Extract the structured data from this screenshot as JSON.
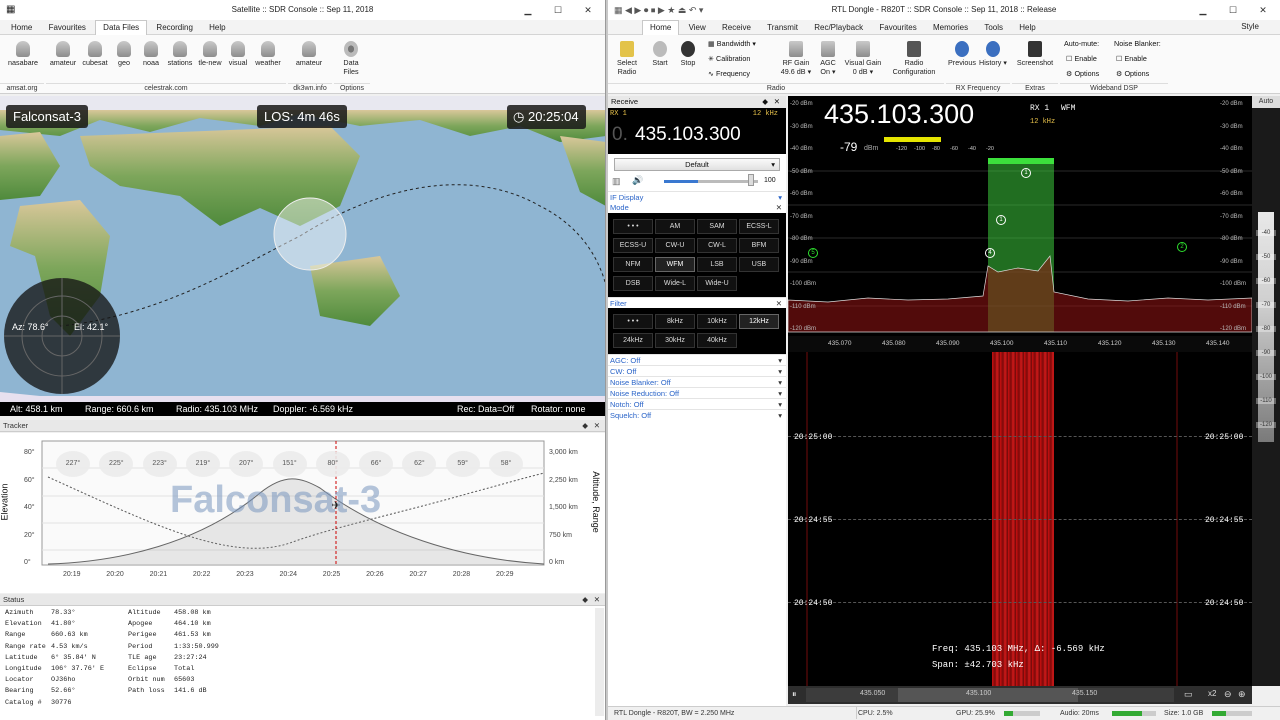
{
  "left": {
    "title": "Satellite :: SDR Console :: Sep 11, 2018",
    "tabs": [
      "Home",
      "Favourites",
      "Data Files",
      "Recording",
      "Help"
    ],
    "active_tab": "Data Files",
    "ribbon_buttons": [
      "nasabare",
      "amateur",
      "cubesat",
      "geo",
      "noaa",
      "stations",
      "tle-new",
      "visual",
      "weather",
      "amateur",
      "Data Files"
    ],
    "group_labels": [
      "amsat.org",
      "celestrak.com",
      "dk3wn.info",
      "Options"
    ],
    "map": {
      "sat_name": "Falconsat-3",
      "los": "LOS: 4m 46s",
      "clock": "20:25:04",
      "az": "Az: 78.6°",
      "el": "El: 42.1°",
      "info": {
        "alt": "Alt: 458.1 km",
        "range": "Range: 660.6 km",
        "radio": "Radio: 435.103 MHz",
        "doppler": "Doppler: -6.569 kHz",
        "rec": "Rec: Data=Off",
        "rotator": "Rotator: none"
      }
    },
    "tracker": {
      "title": "Tracker",
      "watermark": "Falconsat-3",
      "ylabel": "Elevation",
      "y2label": "Altitude, Range",
      "yticks": [
        "80°",
        "60°",
        "40°",
        "20°",
        "0°"
      ],
      "y2ticks": [
        "3,000 km",
        "2,250 km",
        "1,500 km",
        "750 km",
        "0 km"
      ],
      "xticks": [
        "20:19",
        "20:20",
        "20:21",
        "20:22",
        "20:23",
        "20:24",
        "20:25",
        "20:26",
        "20:27",
        "20:28",
        "20:29"
      ],
      "azimuths": [
        "227°",
        "225°",
        "223°",
        "219°",
        "207°",
        "151°",
        "80°",
        "66°",
        "62°",
        "59°",
        "58°"
      ]
    },
    "status": {
      "title": "Status",
      "col1": [
        [
          "Azimuth",
          "78.33°"
        ],
        [
          "Elevation",
          "41.80°"
        ],
        [
          "Range",
          "660.63 km"
        ],
        [
          "Range rate",
          "4.53 km/s"
        ],
        [
          "Latitude",
          "6° 35.84' N"
        ],
        [
          "Longitude",
          "106° 37.76' E"
        ],
        [
          "Locator",
          "OJ36ho"
        ],
        [
          "Bearing",
          "52.66°"
        ],
        [
          "Catalog #",
          "30776"
        ]
      ],
      "col2": [
        [
          "Altitude",
          "458.08 km"
        ],
        [
          "Apogee",
          "464.10 km"
        ],
        [
          "Perigee",
          "461.53 km"
        ],
        [
          "Period",
          "1:33:50.999"
        ],
        [
          "TLE age",
          "23:27:24"
        ],
        [
          "Eclipse",
          "Total"
        ],
        [
          "Orbit num",
          "65603"
        ],
        [
          "Path loss",
          "141.6 dB"
        ]
      ]
    }
  },
  "right": {
    "title": "RTL Dongle - R820T :: SDR Console :: Sep 11, 2018 :: Release",
    "style_label": "Style",
    "tabs": [
      "Home",
      "View",
      "Receive",
      "Transmit",
      "Rec/Playback",
      "Favourites",
      "Memories",
      "Tools",
      "Help"
    ],
    "active_tab": "Home",
    "ribbon": {
      "select_radio": "Select Radio",
      "start": "Start",
      "stop": "Stop",
      "bandwidth": "Bandwidth",
      "calibration": "Calibration",
      "frequency": "Frequency",
      "rf_gain": "RF Gain",
      "rf_gain_val": "49.6 dB",
      "agc": "AGC",
      "agc_val": "On",
      "visual_gain": "Visual Gain",
      "visual_gain_val": "0 dB",
      "radio_config": "Radio Configuration",
      "previous": "Previous",
      "history": "History",
      "screenshot": "Screenshot",
      "automute": "Auto-mute:",
      "enable1": "Enable",
      "options1": "Options",
      "noise_blanker": "Noise Blanker:",
      "enable2": "Enable",
      "options2": "Options",
      "groups": [
        "Radio",
        "RX Frequency",
        "Extras",
        "Wideband DSP"
      ]
    },
    "receive": {
      "title": "Receive",
      "rx": "RX 1",
      "bw": "12 kHz",
      "freq_prefix": "0.",
      "freq": "435.103.300",
      "preset": "Default",
      "volume": "100",
      "if_display": "IF Display",
      "mode": "Mode",
      "modes": [
        "• • •",
        "AM",
        "SAM",
        "ECSS-L",
        "ECSS-U",
        "CW-U",
        "CW-L",
        "BFM",
        "NFM",
        "WFM",
        "LSB",
        "USB",
        "DSB",
        "Wide-L",
        "Wide-U"
      ],
      "selected_mode": "WFM",
      "filter": "Filter",
      "filters": [
        "• • •",
        "8kHz",
        "10kHz",
        "12kHz",
        "24kHz",
        "30kHz",
        "40kHz"
      ],
      "selected_filter": "12kHz",
      "settings": [
        "AGC: Off",
        "CW: Off",
        "Noise Blanker: Off",
        "Noise Reduction: Off",
        "Notch: Off",
        "Squelch: Off"
      ]
    },
    "spectrum": {
      "freq": "435.103.300",
      "rx": "RX 1",
      "mode": "WFM",
      "bw": "12 kHz",
      "level": "-79",
      "level_unit": "dBm",
      "smeter": [
        "-120",
        "-100",
        "-80",
        "-60",
        "-40",
        "-20"
      ],
      "dbm_left": [
        "-20 dBm",
        "-30 dBm",
        "-40 dBm",
        "-50 dBm",
        "-60 dBm",
        "-70 dBm",
        "-80 dBm",
        "-90 dBm",
        "-100 dBm",
        "-110 dBm",
        "-120 dBm"
      ],
      "dbm_right": [
        "-20 dBm",
        "-30 dBm",
        "-40 dBm",
        "-50 dBm",
        "-60 dBm",
        "-70 dBm",
        "-80 dBm",
        "-90 dBm",
        "-100 dBm",
        "-110 dBm",
        "-120 dBm"
      ],
      "freq_ticks": [
        "435.070",
        "435.080",
        "435.090",
        "435.100",
        "435.110",
        "435.120",
        "435.130",
        "435.140"
      ],
      "markers": [
        "1",
        "1",
        "2",
        "4",
        "5"
      ]
    },
    "waterfall": {
      "times": [
        "20:25:00",
        "20:24:55",
        "20:24:50"
      ],
      "readout_freq": "Freq: 435.103 MHz, Δ: -6.569 kHz",
      "readout_span": "Span: ±42.703 kHz",
      "scroll_ticks": [
        "435.050",
        "435.100",
        "435.150"
      ],
      "zoom": "x2"
    },
    "auto": "Auto",
    "scale_right": [
      "-40",
      "-50",
      "-60",
      "-70",
      "-80",
      "-90",
      "-100",
      "-110",
      "-120"
    ],
    "statusbar": {
      "device": "RTL Dongle - R820T, BW = 2.250 MHz",
      "cpu": "CPU: 2.5%",
      "gpu": "GPU: 25.9%",
      "audio": "Audio: 20ms",
      "size": "Size: 1.0 GB"
    }
  }
}
